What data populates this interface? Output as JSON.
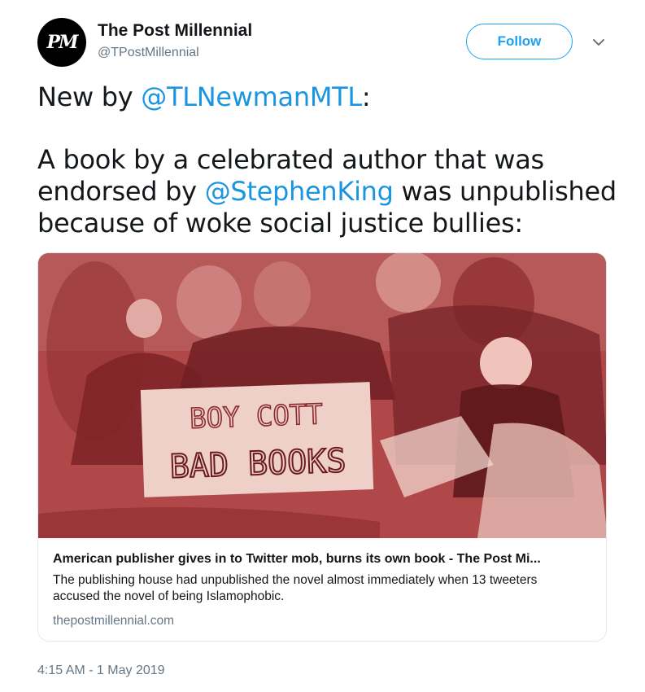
{
  "account": {
    "avatar_text": "PM",
    "name": "The Post Millennial",
    "handle": "@TPostMillennial"
  },
  "actions": {
    "follow_label": "Follow"
  },
  "tweet": {
    "line1_prefix": "New by ",
    "line1_mention": "@TLNewmanMTL",
    "line1_suffix": ":",
    "line2": "A book by a celebrated author that was",
    "line3_prefix": "endorsed by ",
    "line3_mention": "@StephenKing",
    "line3_suffix": " was unpublished",
    "line4": "because of woke social justice bullies:"
  },
  "card": {
    "image_sign_line1": "BOY COTT",
    "image_sign_line2": "BAD BOOKS",
    "title": "American publisher gives in to Twitter mob, burns its own book - The Post Mi...",
    "description": "The publishing house had unpublished the novel almost immediately when 13 tweeters accused the novel of being Islamophobic.",
    "domain": "thepostmillennial.com"
  },
  "meta": {
    "timestamp": "4:15 AM - 1 May 2019"
  },
  "colors": {
    "accent": "#1da1f2",
    "mention": "#1b95e0",
    "muted": "#657786",
    "photo_tint": "#a8403f"
  }
}
